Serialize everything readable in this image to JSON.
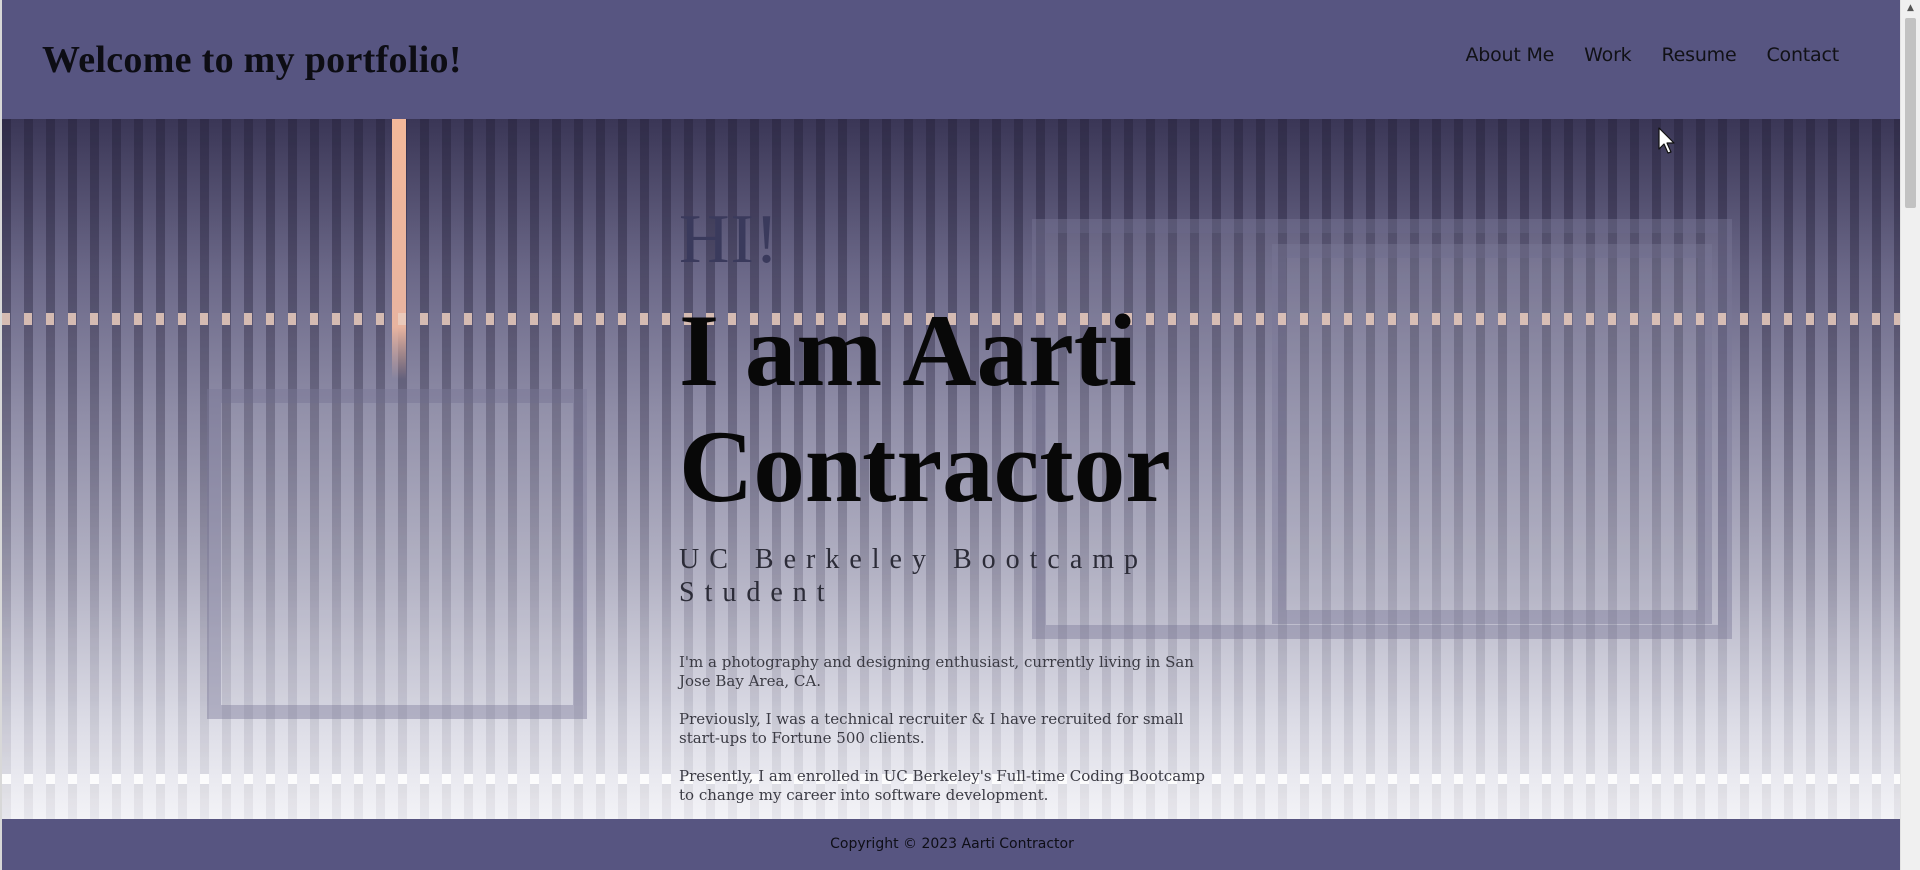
{
  "header": {
    "title": "Welcome to my portfolio!",
    "nav": [
      {
        "label": "About Me"
      },
      {
        "label": "Work"
      },
      {
        "label": "Resume"
      },
      {
        "label": "Contact"
      }
    ]
  },
  "hero": {
    "greeting": "HI!",
    "name": "I am Aarti Contractor",
    "role": "UC Berkeley Bootcamp Student",
    "paragraphs": [
      "I'm a photography and designing enthusiast, currently living in San Jose Bay Area, CA.",
      "Previously, I was a technical recruiter & I have recruited for small start-ups to Fortune 500 clients.",
      "Presently, I am enrolled in UC Berkeley's Full-time Coding Bootcamp to change my career into software development."
    ]
  },
  "footer": {
    "copyright": "Copyright © 2023 Aarti Contractor"
  },
  "colors": {
    "header_bg": "#575581",
    "footer_bg": "#575581",
    "greeting": "#3a3a5c",
    "name": "#080808"
  },
  "icons": {
    "scroll_up": "scroll-up-arrow-icon",
    "cursor": "mouse-pointer-icon"
  }
}
